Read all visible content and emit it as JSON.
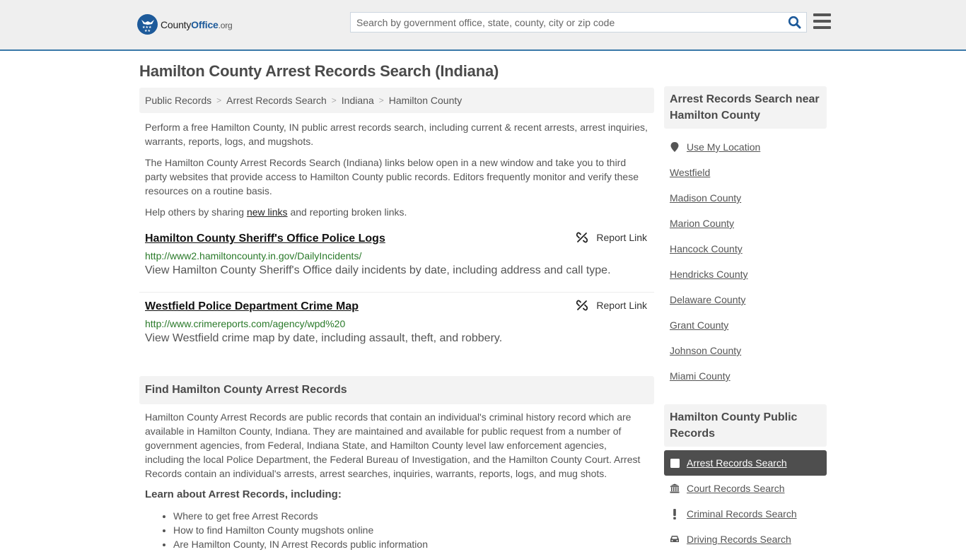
{
  "header": {
    "logo": {
      "name_part1": "County",
      "name_part2": "Office",
      "tld": ".org"
    },
    "search": {
      "placeholder": "Search by government office, state, county, city or zip code",
      "value": ""
    },
    "colors": {
      "brand": "#1d5a9a",
      "header_border": "#3a78a8"
    }
  },
  "page": {
    "title": "Hamilton County Arrest Records Search (Indiana)",
    "breadcrumb": [
      {
        "label": "Public Records"
      },
      {
        "label": "Arrest Records Search"
      },
      {
        "label": "Indiana"
      },
      {
        "label": "Hamilton County"
      }
    ],
    "breadcrumb_separator": ">",
    "intro": {
      "p1": "Perform a free Hamilton County, IN public arrest records search, including current & recent arrests, arrest inquiries, warrants, reports, logs, and mugshots.",
      "p2": "The Hamilton County Arrest Records Search (Indiana) links below open in a new window and take you to third party websites that provide access to Hamilton County public records. Editors frequently monitor and verify these resources on a routine basis.",
      "p3_before": "Help others by sharing ",
      "p3_link": "new links",
      "p3_after": " and reporting broken links."
    },
    "links": [
      {
        "title": "Hamilton County Sheriff's Office Police Logs",
        "url": "http://www2.hamiltoncounty.in.gov/DailyIncidents/",
        "description": "View Hamilton County Sheriff's Office daily incidents by date, including address and call type.",
        "report_label": "Report Link"
      },
      {
        "title": "Westfield Police Department Crime Map",
        "url": "http://www.crimereports.com/agency/wpd%20",
        "description": "View Westfield crime map by date, including assault, theft, and robbery.",
        "report_label": "Report Link"
      }
    ],
    "find_section": {
      "heading": "Find Hamilton County Arrest Records",
      "body": "Hamilton County Arrest Records are public records that contain an individual's criminal history record which are available in Hamilton County, Indiana. They are maintained and available for public request from a number of government agencies, from Federal, Indiana State, and Hamilton County level law enforcement agencies, including the local Police Department, the Federal Bureau of Investigation, and the Hamilton County Court. Arrest Records contain an individual's arrests, arrest searches, inquiries, warrants, reports, logs, and mug shots.",
      "learn_heading": "Learn about Arrest Records, including:",
      "learn_items": [
        "Where to get free Arrest Records",
        "How to find Hamilton County mugshots online",
        "Are Hamilton County, IN Arrest Records public information"
      ]
    }
  },
  "sidebar": {
    "nearby": {
      "heading": "Arrest Records Search near Hamilton County",
      "use_location": "Use My Location",
      "items": [
        "Westfield",
        "Madison County",
        "Marion County",
        "Hancock County",
        "Hendricks County",
        "Delaware County",
        "Grant County",
        "Johnson County",
        "Miami County"
      ]
    },
    "public_records": {
      "heading": "Hamilton County Public Records",
      "items": [
        {
          "label": "Arrest Records Search",
          "icon": "square-icon",
          "active": true
        },
        {
          "label": "Court Records Search",
          "icon": "courthouse-icon",
          "active": false
        },
        {
          "label": "Criminal Records Search",
          "icon": "exclamation-icon",
          "active": false
        },
        {
          "label": "Driving Records Search",
          "icon": "car-icon",
          "active": false
        }
      ]
    }
  }
}
